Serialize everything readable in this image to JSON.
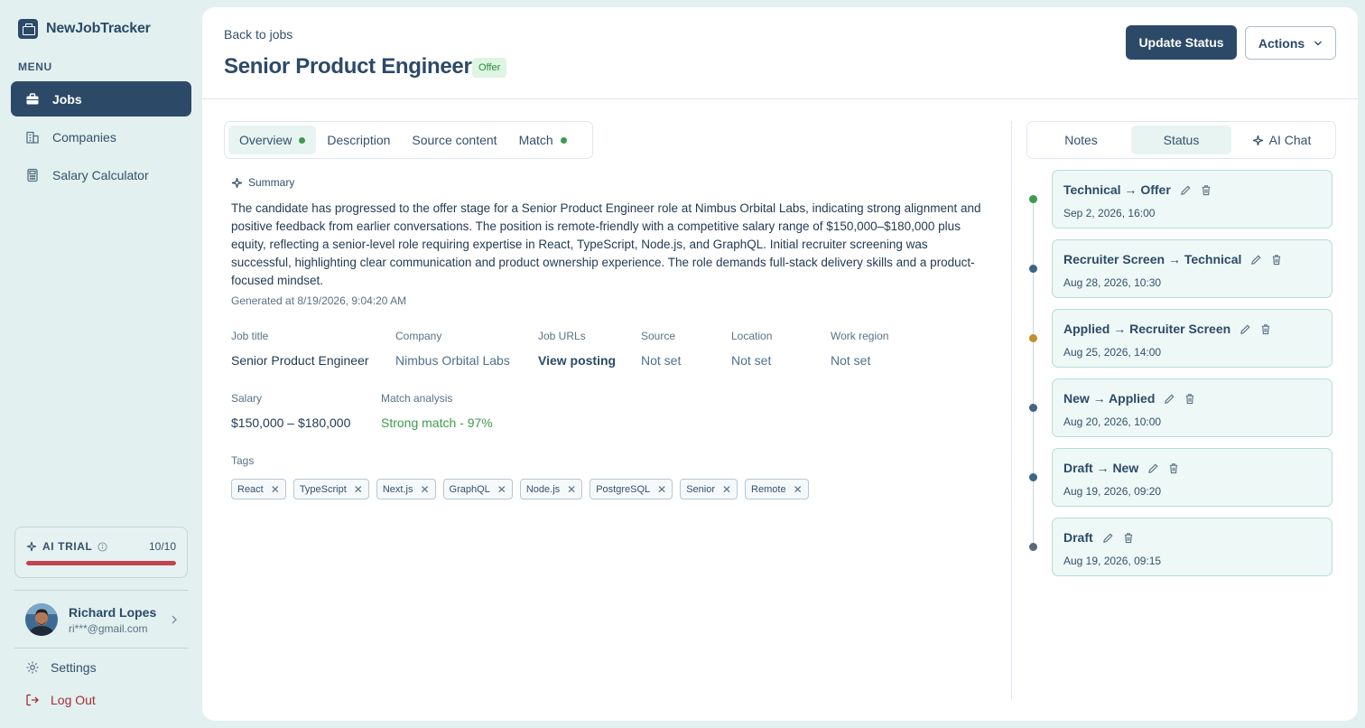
{
  "brand": {
    "name": "NewJobTracker"
  },
  "sidebar": {
    "menu_label": "MENU",
    "items": [
      {
        "label": "Jobs",
        "icon": "briefcase-icon",
        "active": true
      },
      {
        "label": "Companies",
        "icon": "building-icon",
        "active": false
      },
      {
        "label": "Salary Calculator",
        "icon": "calculator-icon",
        "active": false
      }
    ],
    "ai_trial": {
      "label": "AI TRIAL",
      "count": "10/10",
      "progress": 1.0
    },
    "user": {
      "name": "Richard Lopes",
      "email": "ri***@gmail.com"
    },
    "settings_label": "Settings",
    "logout_label": "Log Out"
  },
  "header": {
    "back_label": "Back to jobs",
    "title": "Senior Product Engineer",
    "status_badge": "Offer",
    "update_button": "Update Status",
    "actions_button": "Actions"
  },
  "tabs": [
    {
      "label": "Overview",
      "dot": true,
      "active": true
    },
    {
      "label": "Description",
      "dot": false,
      "active": false
    },
    {
      "label": "Source content",
      "dot": false,
      "active": false
    },
    {
      "label": "Match",
      "dot": true,
      "active": false
    }
  ],
  "overview": {
    "summary_label": "Summary",
    "summary_text": "The candidate has progressed to the offer stage for a Senior Product Engineer role at Nimbus Orbital Labs, indicating strong alignment and positive feedback from earlier conversations. The position is remote-friendly with a competitive salary range of $150,000–$180,000 plus equity, reflecting a senior-level role requiring expertise in React, TypeScript, Node.js, and GraphQL. Initial recruiter screening was successful, highlighting clear communication and product ownership experience. The role demands full-stack delivery skills and a product-focused mindset.",
    "generated_at": "Generated at 8/19/2026, 9:04:20 AM",
    "fields": {
      "job_title": {
        "label": "Job title",
        "value": "Senior Product Engineer"
      },
      "company": {
        "label": "Company",
        "value": "Nimbus Orbital Labs"
      },
      "job_urls": {
        "label": "Job URLs",
        "value": "View posting"
      },
      "source": {
        "label": "Source",
        "value": "Not set"
      },
      "location": {
        "label": "Location",
        "value": "Not set"
      },
      "work_region": {
        "label": "Work region",
        "value": "Not set"
      },
      "salary": {
        "label": "Salary",
        "value": "$150,000 – $180,000"
      },
      "match": {
        "label": "Match analysis",
        "value": "Strong match - 97%"
      }
    },
    "tags_label": "Tags",
    "tags": [
      "React",
      "TypeScript",
      "Next.js",
      "GraphQL",
      "Node.js",
      "PostgreSQL",
      "Senior",
      "Remote"
    ]
  },
  "right_panel": {
    "tabs": [
      {
        "label": "Notes",
        "active": false
      },
      {
        "label": "Status",
        "active": true
      },
      {
        "label": "AI Chat",
        "active": false
      }
    ],
    "history": [
      {
        "title": "Technical → Offer",
        "date": "Sep 2, 2026, 16:00",
        "dot_color": "#3f9a4d"
      },
      {
        "title": "Recruiter Screen → Technical",
        "date": "Aug 28, 2026, 10:30",
        "dot_color": "#3d6585"
      },
      {
        "title": "Applied → Recruiter Screen",
        "date": "Aug 25, 2026, 14:00",
        "dot_color": "#c0902a"
      },
      {
        "title": "New → Applied",
        "date": "Aug 20, 2026, 10:00",
        "dot_color": "#3d6585"
      },
      {
        "title": "Draft → New",
        "date": "Aug 19, 2026, 09:20",
        "dot_color": "#3d6585"
      },
      {
        "title": "Draft",
        "date": "Aug 19, 2026, 09:15",
        "dot_color": "#5a6878"
      }
    ]
  },
  "colors": {
    "primary": "#2c4a68",
    "accent_green": "#3f9a4d",
    "danger": "#c2424e",
    "page_bg": "#e2f0ef"
  }
}
